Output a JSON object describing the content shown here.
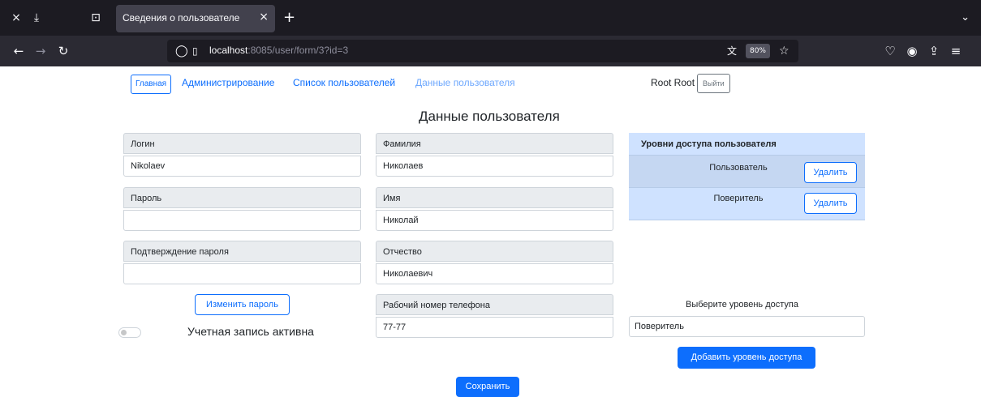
{
  "browser": {
    "tab_title": "Сведения о пользователе",
    "url_host": "localhost",
    "url_rest": ":8085/user/form/3?id=3",
    "zoom": "80%"
  },
  "nav": {
    "home": "Главная",
    "admin": "Администрирование",
    "users_list": "Список пользователей",
    "user_data": "Данные пользователя",
    "user_name": "Root Root",
    "logout": "Выйти"
  },
  "page": {
    "title": "Данные пользователя"
  },
  "form": {
    "login_label": "Логин",
    "login_value": "Nikolaev",
    "password_label": "Пароль",
    "password_value": "",
    "confirm_label": "Подтверждение пароля",
    "confirm_value": "",
    "change_password": "Изменить пароль",
    "surname_label": "Фамилия",
    "surname_value": "Николаев",
    "name_label": "Имя",
    "name_value": "Николай",
    "patronymic_label": "Отчество",
    "patronymic_value": "Николаевич",
    "phone_label": "Рабочий номер телефона",
    "phone_value": "77-77",
    "active_label": "Учетная запись активна",
    "active": false
  },
  "access": {
    "header": "Уровни доступа пользователя",
    "rows": [
      {
        "name": "Пользователь",
        "delete": "Удалить"
      },
      {
        "name": "Поверитель",
        "delete": "Удалить"
      }
    ],
    "select_label": "Выберите уровень доступа",
    "select_value": "Поверитель",
    "add_button": "Добавить уровень доступа"
  },
  "save_button": "Сохранить"
}
